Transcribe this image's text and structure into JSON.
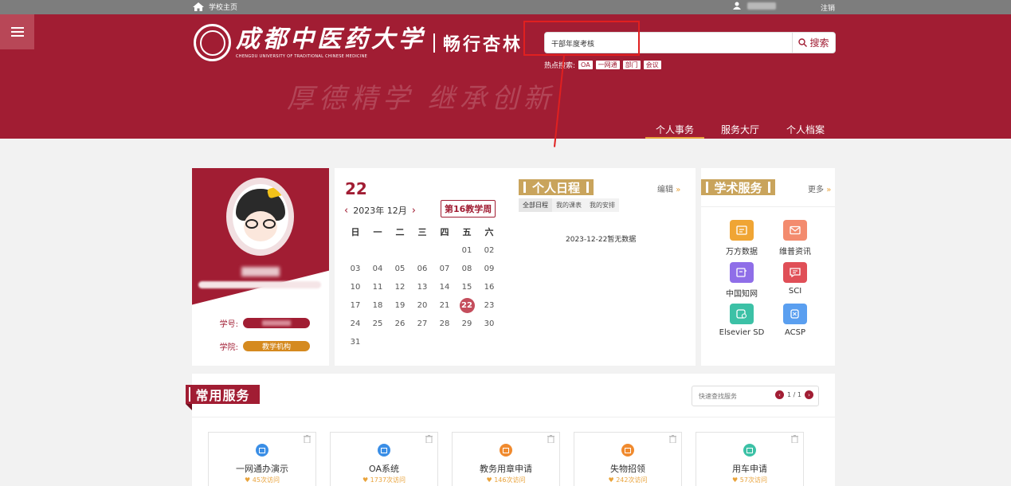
{
  "topbar": {
    "home_label": "学校主页",
    "logout_label": "注销"
  },
  "header": {
    "school_name_cn": "成都中医药大学",
    "school_name_en": "CHENGDU UNIVERSITY OF TRADITIONAL CHINESE MEDICINE",
    "app_name": "畅行杏林",
    "watermark": "厚德精学  继承创新",
    "search": {
      "value": "干部年度考核",
      "button_label": "搜索"
    },
    "hot": {
      "label": "热点搜索:",
      "tags": [
        "OA",
        "一网通",
        "部门",
        "会议"
      ]
    },
    "tabs": [
      "个人事务",
      "服务大厅",
      "个人档案"
    ]
  },
  "profile": {
    "student_id_label": "学号:",
    "college_label": "学院:",
    "college_value": "教学机构"
  },
  "calendar": {
    "day": "22",
    "month_label": "2023年 12月",
    "week_badge": "第16教学周",
    "weekdays": [
      "日",
      "一",
      "二",
      "三",
      "四",
      "五",
      "六"
    ],
    "dates": [
      "",
      "",
      "",
      "",
      "",
      "01",
      "02",
      "03",
      "04",
      "05",
      "06",
      "07",
      "08",
      "09",
      "10",
      "11",
      "12",
      "13",
      "14",
      "15",
      "16",
      "17",
      "18",
      "19",
      "20",
      "21",
      "22",
      "23",
      "24",
      "25",
      "26",
      "27",
      "28",
      "29",
      "30",
      "31",
      "",
      "",
      "",
      "",
      "",
      ""
    ],
    "today": "22"
  },
  "schedule": {
    "title": "个人日程",
    "edit_label": "编辑",
    "tabs": [
      "全部日程",
      "我的课表",
      "我的安排"
    ],
    "empty_text": "2023-12-22暂无数据"
  },
  "academic": {
    "title": "学术服务",
    "more_label": "更多",
    "items": [
      {
        "label": "万方数据",
        "icon": "wanfang-icon",
        "color": "#f0a534"
      },
      {
        "label": "维普资讯",
        "icon": "mail-icon",
        "color": "#f38b6e"
      },
      {
        "label": "中国知网",
        "icon": "cnki-icon",
        "color": "#8f6ee8"
      },
      {
        "label": "SCI",
        "icon": "chat-icon",
        "color": "#e04f57"
      },
      {
        "label": "Elsevier SD",
        "icon": "elsevier-icon",
        "color": "#3cc1a6"
      },
      {
        "label": "ACSP",
        "icon": "acsp-icon",
        "color": "#5a9ff0"
      }
    ]
  },
  "services": {
    "title": "常用服务",
    "search_placeholder": "快速查找服务",
    "pager": "1 / 1",
    "items": [
      {
        "name": "一网通办演示",
        "visits": "45次访问",
        "color": "#3a8ee6"
      },
      {
        "name": "OA系统",
        "visits": "1737次访问",
        "color": "#3a8ee6"
      },
      {
        "name": "教务用章申请",
        "visits": "146次访问",
        "color": "#f08a2e"
      },
      {
        "name": "失物招领",
        "visits": "242次访问",
        "color": "#f08a2e"
      },
      {
        "name": "用车申请",
        "visits": "57次访问",
        "color": "#3cc1a6"
      }
    ]
  },
  "colors": {
    "brand": "#a11d33",
    "gold": "#c9a45c",
    "accent": "#e9a33b",
    "annotation": "#e02020"
  }
}
